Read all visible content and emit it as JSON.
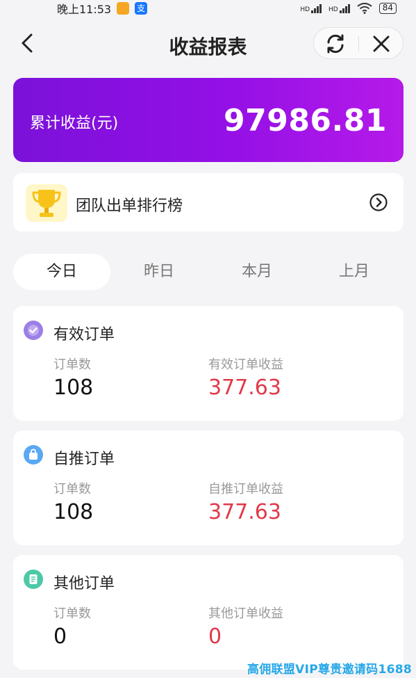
{
  "status_bar": {
    "time": "晚上11:53",
    "network_label_1": "HD",
    "network_label_2": "HD",
    "battery": "84"
  },
  "header": {
    "title": "收益报表",
    "back_icon": "chevron-left-icon",
    "refresh_icon": "refresh-icon",
    "close_icon": "close-icon"
  },
  "earnings": {
    "label": "累计收益(元)",
    "value": "97986.81"
  },
  "ranking": {
    "label": "团队出单排行榜",
    "icon": "trophy-icon"
  },
  "tabs": [
    {
      "label": "今日",
      "active": true
    },
    {
      "label": "昨日",
      "active": false
    },
    {
      "label": "本月",
      "active": false
    },
    {
      "label": "上月",
      "active": false
    }
  ],
  "orders": [
    {
      "title": "有效订单",
      "count_label": "订单数",
      "count": "108",
      "income_label": "有效订单收益",
      "income": "377.63",
      "icon_color": "#9b7fe6"
    },
    {
      "title": "自推订单",
      "count_label": "订单数",
      "count": "108",
      "income_label": "自推订单收益",
      "income": "377.63",
      "icon_color": "#5aa8f2"
    },
    {
      "title": "其他订单",
      "count_label": "订单数",
      "count": "0",
      "income_label": "其他订单收益",
      "income": "0",
      "icon_color": "#4cc9a6"
    }
  ],
  "watermark": "高佣联盟VIP尊贵邀请码1688",
  "colors": {
    "accent_purple": "#8a12e0",
    "income_red": "#e0394a",
    "watermark_blue": "#27a8e8"
  }
}
